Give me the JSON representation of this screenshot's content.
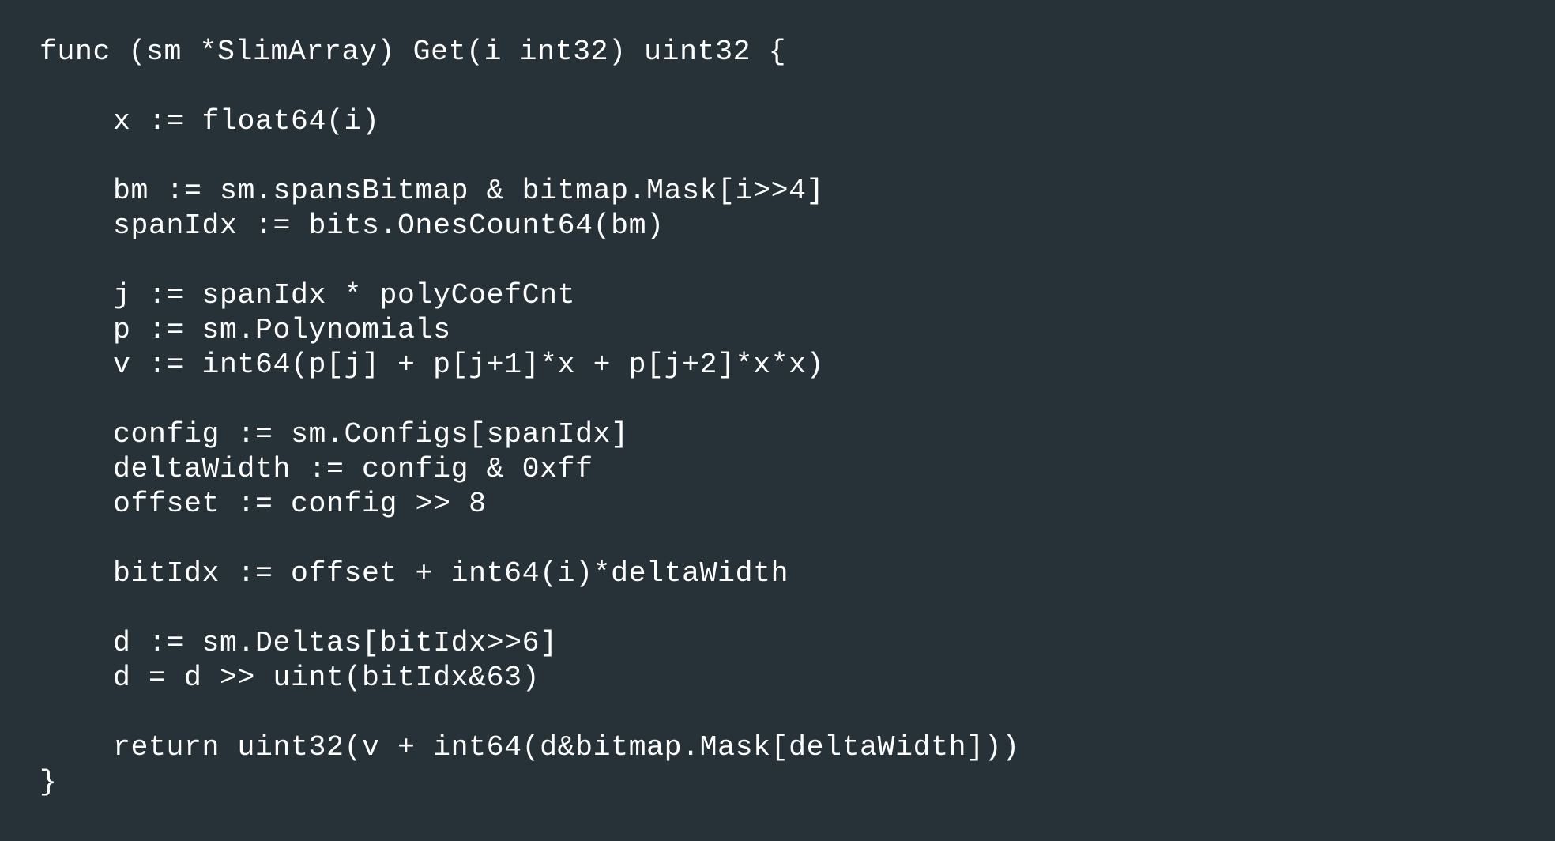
{
  "code": {
    "language": "Go",
    "lines": [
      "func (sm *SlimArray) Get(i int32) uint32 {",
      "",
      "x := float64(i)",
      "",
      "bm := sm.spansBitmap & bitmap.Mask[i>>4]",
      "spanIdx := bits.OnesCount64(bm)",
      "",
      "j := spanIdx * polyCoefCnt",
      "p := sm.Polynomials",
      "v := int64(p[j] + p[j+1]*x + p[j+2]*x*x)",
      "",
      "config := sm.Configs[spanIdx]",
      "deltaWidth := config & 0xff",
      "offset := config >> 8",
      "",
      "bitIdx := offset + int64(i)*deltaWidth",
      "",
      "d := sm.Deltas[bitIdx>>6]",
      "d = d >> uint(bitIdx&63)",
      "",
      "return uint32(v + int64(d&bitmap.Mask[deltaWidth]))",
      "}"
    ]
  },
  "colors": {
    "background": "#263238",
    "text": "#ffffff"
  }
}
